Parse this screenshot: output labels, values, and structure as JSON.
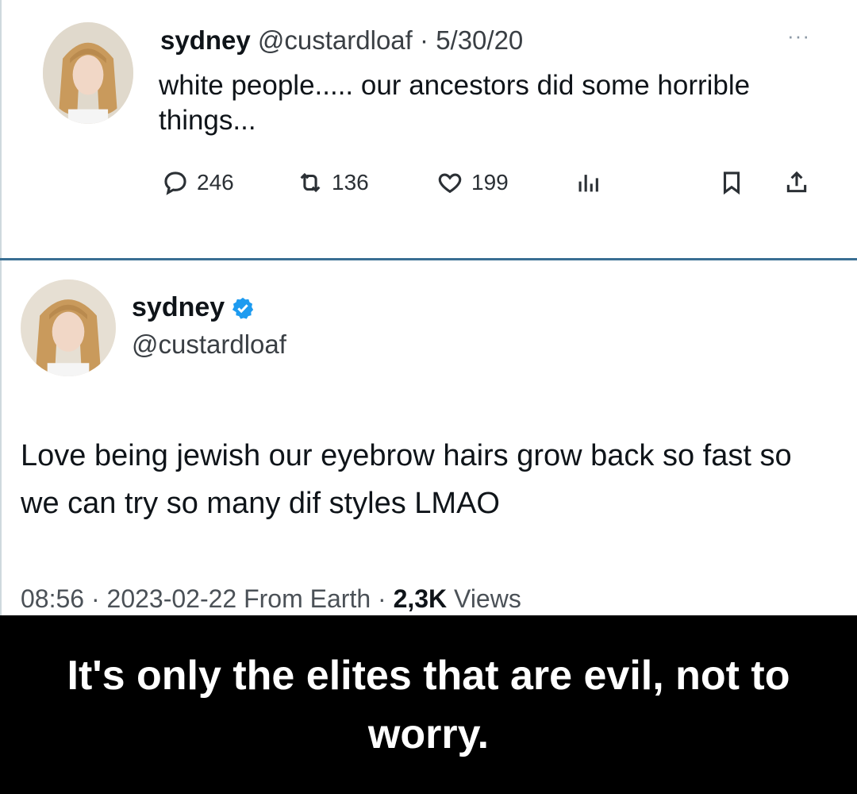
{
  "tweet1": {
    "name": "sydney",
    "handle": "@custardloaf",
    "separator": "·",
    "date": "5/30/20",
    "more": "···",
    "text": "white people..... our ancestors did some horrible things...",
    "actions": {
      "replies": "246",
      "retweets": "136",
      "likes": "199"
    }
  },
  "tweet2": {
    "name": "sydney",
    "handle": "@custardloaf",
    "text": "Love being jewish our eyebrow hairs grow back so fast so we can try so many dif styles LMAO",
    "time": "08:56",
    "separator": "·",
    "date": "2023-02-22",
    "source": "From Earth",
    "views_count": "2,3K",
    "views_label": "Views",
    "verified_color": "#1d9bf0"
  },
  "caption": {
    "text": "It's only the elites that are evil, not to worry."
  },
  "icons": [
    "more-icon",
    "reply-icon",
    "retweet-icon",
    "like-icon",
    "analytics-icon",
    "bookmark-icon",
    "share-icon",
    "verified-badge-icon"
  ]
}
